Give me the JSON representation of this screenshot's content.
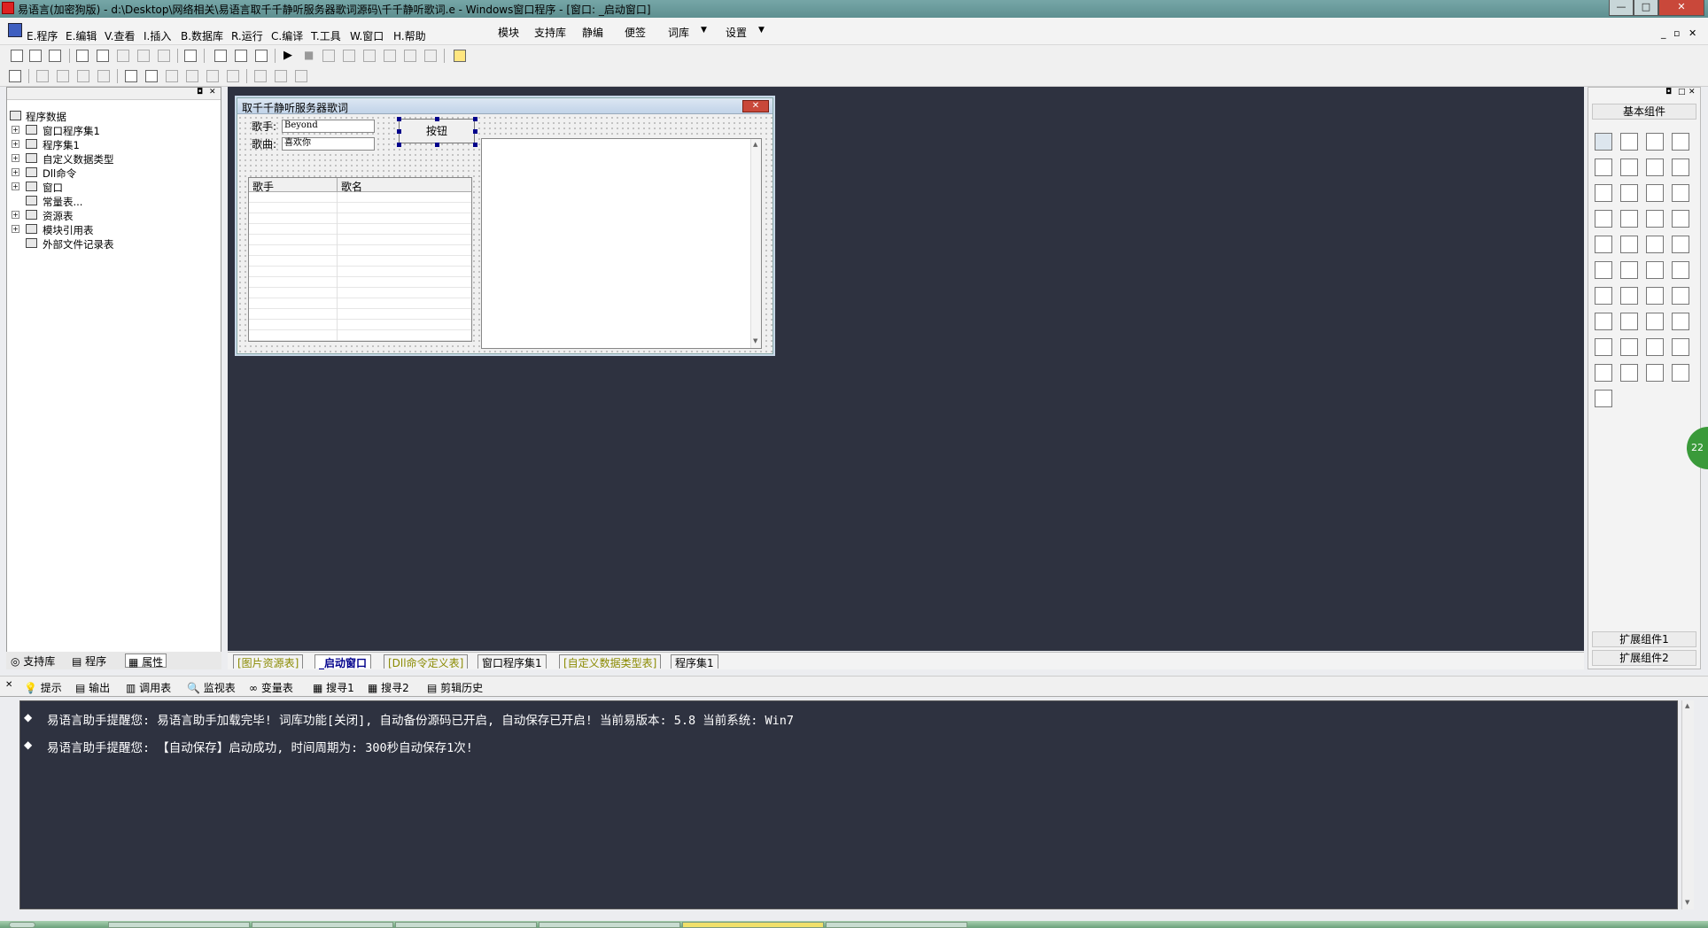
{
  "window": {
    "title": "易语言(加密狗版) - d:\\Desktop\\网络相关\\易语言取千千静听服务器歌词源码\\千千静听歌词.e - Windows窗口程序 - [窗口: _启动窗口]",
    "min": "—",
    "max": "□",
    "close": "✕"
  },
  "menu": {
    "items": [
      "E.程序",
      "E.编辑",
      "V.查看",
      "I.插入",
      "B.数据库",
      "R.运行",
      "C.编译",
      "T.工具",
      "W.窗口",
      "H.帮助"
    ],
    "extra": [
      "模块",
      "支持库",
      "静编",
      "便签",
      "词库",
      "设置"
    ]
  },
  "tree": {
    "root": "程序数据",
    "items": [
      "窗口程序集1",
      "程序集1",
      "自定义数据类型",
      "Dll命令",
      "窗口",
      "常量表...",
      "资源表",
      "模块引用表",
      "外部文件记录表"
    ]
  },
  "left_tabs": [
    "支持库",
    "程序",
    "属性"
  ],
  "form": {
    "title": "取千千静听服务器歌词",
    "singer_label": "歌手:",
    "singer_value": "Beyond",
    "song_label": "歌曲:",
    "song_value": "喜欢你",
    "button_label": "按钮",
    "col_singer": "歌手",
    "col_song": "歌名"
  },
  "design_tabs": [
    "[图片资源表]",
    "_启动窗口",
    "[Dll命令定义表]",
    "窗口程序集1",
    "[自定义数据类型表]",
    "程序集1"
  ],
  "right_panel": {
    "header": "基本组件",
    "ext1": "扩展组件1",
    "ext2": "扩展组件2"
  },
  "output_tabs": [
    "提示",
    "输出",
    "调用表",
    "监视表",
    "变量表",
    "搜寻1",
    "搜寻2",
    "剪辑历史"
  ],
  "output_lines": [
    "易语言助手提醒您:  易语言助手加载完毕! 词库功能[关闭], 自动备份源码已开启, 自动保存已开启! 当前易版本: 5.8  当前系统: Win7",
    "易语言助手提醒您: 【自动保存】启动成功, 时间周期为: 300秒自动保存1次!"
  ],
  "badge": "22",
  "colors": {
    "dark_bg": "#2e3240",
    "titlebar": "#6b9b9c",
    "close_red": "#c9483a",
    "tab_olive": "#8a8a00"
  }
}
